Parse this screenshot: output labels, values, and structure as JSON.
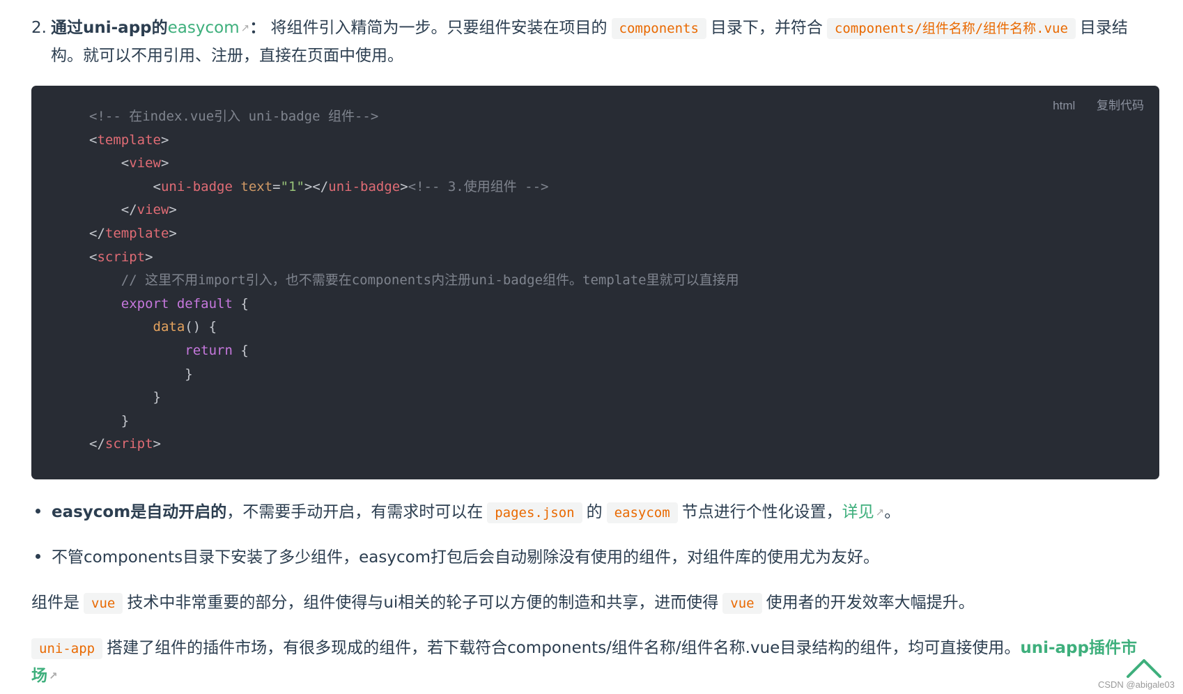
{
  "item2": {
    "num": "2.",
    "bold_prefix": "通过uni-app的",
    "link": "easycom",
    "colon": "：",
    "text1": "将组件引入精简为一步。只要组件安装在项目的",
    "code1": "components",
    "text2": "目录下，并符合",
    "code2": "components/组件名称/组件名称.vue",
    "text3": "目录结",
    "text4": "构。就可以不用引用、注册，直接在页面中使用。"
  },
  "code_block": {
    "lang": "html",
    "copy_label": "复制代码",
    "lines": {
      "l1": "<!-- 在index.vue引入 uni-badge 组件-->",
      "l2_tag": "template",
      "l3_tag": "view",
      "l4_tag": "uni-badge",
      "l4_attr": "text",
      "l4_val": "\"1\"",
      "l4_comment": "<!-- 3.使用组件 -->",
      "l5_tag": "view",
      "l6_tag": "template",
      "l7_tag": "script",
      "l8_comment": "// 这里不用import引入，也不需要在components内注册uni-badge组件。template里就可以直接用",
      "l9_kw": "export default",
      "l9_rest": " {",
      "l10_fn": "data",
      "l10_rest": "() {",
      "l11_kw": "return",
      "l11_rest": " {",
      "l12": "}",
      "l13": "}",
      "l14": "}",
      "l15_tag": "script"
    }
  },
  "bullet1": {
    "bold": "easycom是自动开启的",
    "text1": "，不需要手动开启，有需求时可以在",
    "code1": "pages.json",
    "text2": "的",
    "code2": "easycom",
    "text3": "节点进行个性化设置，",
    "link": "详见",
    "end": "。"
  },
  "bullet2": {
    "text": "不管components目录下安装了多少组件，easycom打包后会自动剔除没有使用的组件，对组件库的使用尤为友好。"
  },
  "para1": {
    "text1": "组件是",
    "code1": "vue",
    "text2": "技术中非常重要的部分，组件使得与ui相关的轮子可以方便的制造和共享，进而使得",
    "code2": "vue",
    "text3": "使用者的开发效率大幅提升。"
  },
  "para2": {
    "code1": "uni-app",
    "text1": "搭建了组件的插件市场，有很多现成的组件，若下载符合components/组件名称/组件名称.vue目录结构的组件，均可直接使用。",
    "link_a": "uni-app插件市",
    "link_b": "场"
  },
  "watermark": "CSDN @abigale03",
  "colors": {
    "link": "#3eaf7c",
    "inline_code": "#e96900",
    "code_bg": "#282c34"
  },
  "icons": [
    "external-link-icon",
    "back-to-top-icon"
  ]
}
